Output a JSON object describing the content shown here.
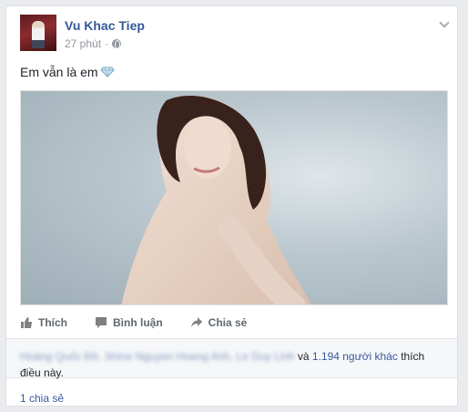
{
  "post": {
    "author": "Vu Khac Tiep",
    "time": "27 phút",
    "time_sep": "·",
    "caption": "Em vẫn là em"
  },
  "actions": {
    "like": "Thích",
    "comment": "Bình luận",
    "share": "Chia sẻ"
  },
  "likes": {
    "names": "Hoàng Quốc Đề, Shine Nguyen Hoang Anh, Le Duy Linh",
    "and": " và ",
    "others": "1.194 người khác",
    "suffix": " thích điều này."
  },
  "shares": "1 chia sẻ",
  "colors": {
    "link": "#365899",
    "muted": "#90949c",
    "action": "#616770"
  },
  "icons": [
    "chevron-down-icon",
    "globe-icon",
    "diamond-icon",
    "like-icon",
    "comment-icon",
    "share-icon"
  ]
}
